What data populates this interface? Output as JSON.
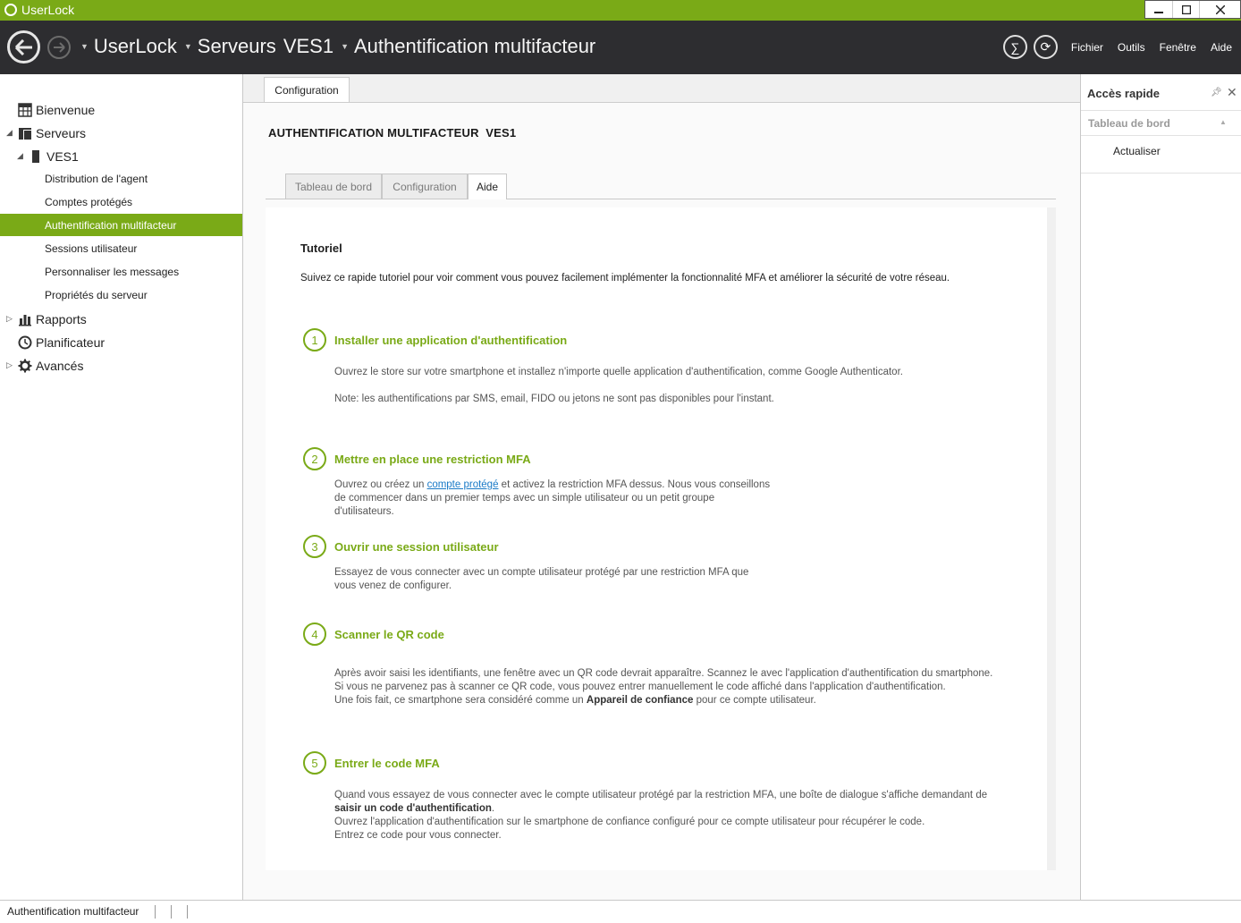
{
  "window": {
    "title": "UserLock",
    "controls": [
      "minimize",
      "maximize",
      "close"
    ]
  },
  "navbar": {
    "breadcrumbs": [
      "UserLock",
      "Serveurs",
      "VES1",
      "Authentification multifacteur"
    ],
    "menu": [
      "Fichier",
      "Outils",
      "Fenêtre",
      "Aide"
    ],
    "icons": [
      "back-arrow-icon",
      "forward-arrow-icon",
      "sigma-icon",
      "refresh-icon"
    ]
  },
  "sidebar": {
    "items": [
      {
        "label": "Bienvenue",
        "level": 0,
        "expander": "",
        "icon": "dashboard-icon"
      },
      {
        "label": "Serveurs",
        "level": 0,
        "expander": "expanded",
        "icon": "servers-icon"
      },
      {
        "label": "VES1",
        "level": 1,
        "expander": "expanded",
        "icon": "server-icon"
      },
      {
        "label": "Distribution de l'agent",
        "level": 2
      },
      {
        "label": "Comptes protégés",
        "level": 2
      },
      {
        "label": "Authentification multifacteur",
        "level": 2,
        "selected": true
      },
      {
        "label": "Sessions utilisateur",
        "level": 2
      },
      {
        "label": "Personnaliser les messages",
        "level": 2
      },
      {
        "label": "Propriétés du serveur",
        "level": 2
      },
      {
        "label": "Rapports",
        "level": 0,
        "expander": "collapsed",
        "icon": "reports-icon"
      },
      {
        "label": "Planificateur",
        "level": 0,
        "expander": "",
        "icon": "clock-icon"
      },
      {
        "label": "Avancés",
        "level": 0,
        "expander": "collapsed",
        "icon": "gear-icon"
      }
    ]
  },
  "main": {
    "top_tab": "Configuration",
    "section_title": "AUTHENTIFICATION MULTIFACTEUR  VES1",
    "subtabs": [
      "Tableau de bord",
      "Configuration",
      "Aide"
    ],
    "active_subtab": "Aide",
    "tutorial": {
      "title": "Tutoriel",
      "intro": "Suivez ce rapide tutoriel pour voir comment vous pouvez facilement implémenter la fonctionnalité MFA et améliorer la sécurité de votre réseau.",
      "steps": [
        {
          "number": "1",
          "title": "Installer une application d'authentification",
          "line1": "Ouvrez le store sur votre smartphone et installez n'importe quelle application d'authentification, comme Google Authenticator.",
          "line2": "Note: les authentifications par SMS, email, FIDO ou jetons ne sont pas disponibles pour l'instant."
        },
        {
          "number": "2",
          "title": "Mettre en place une restriction MFA",
          "pre_link": "Ouvrez ou créez un ",
          "link": "compte protégé",
          "post_link": " et activez la restriction MFA dessus. Nous vous conseillons",
          "line2": "de commencer dans un premier temps avec un simple utilisateur ou un petit groupe",
          "line3": "d'utilisateurs."
        },
        {
          "number": "3",
          "title": "Ouvrir une session utilisateur",
          "line1": "Essayez de vous connecter avec un compte utilisateur protégé par une restriction MFA que",
          "line2": "vous venez de configurer."
        },
        {
          "number": "4",
          "title": "Scanner le QR code",
          "line1": "Après avoir saisi les identifiants, une fenêtre avec un QR code devrait apparaître. Scannez le avec l'application d'authentification du smartphone.",
          "line2": "Si vous ne parvenez pas à scanner ce QR code, vous pouvez entrer manuellement le code affiché dans l'application d'authentification.",
          "line3_pre": "Une fois fait, ce smartphone sera considéré comme un ",
          "line3_bold": "Appareil de confiance",
          "line3_post": " pour ce compte utilisateur."
        },
        {
          "number": "5",
          "title": "Entrer le code MFA",
          "line1": "Quand vous essayez de vous connecter avec le compte utilisateur protégé par la restriction MFA, une boîte de dialogue s'affiche demandant de",
          "line2_bold": "saisir un code d'authentification",
          "line2_post": ".",
          "line3": "Ouvrez l'application d'authentification sur le smartphone de confiance configuré pour ce compte utilisateur pour récupérer le code.",
          "line4": "Entrez ce code pour vous connecter."
        }
      ]
    }
  },
  "right_panel": {
    "title": "Accès rapide",
    "section": "Tableau de bord",
    "actions": [
      "Actualiser"
    ]
  },
  "statusbar": {
    "text": "Authentification multifacteur"
  },
  "colors": {
    "accent": "#7aaa17",
    "navbar": "#2d2d30",
    "link": "#1a7ac7"
  }
}
